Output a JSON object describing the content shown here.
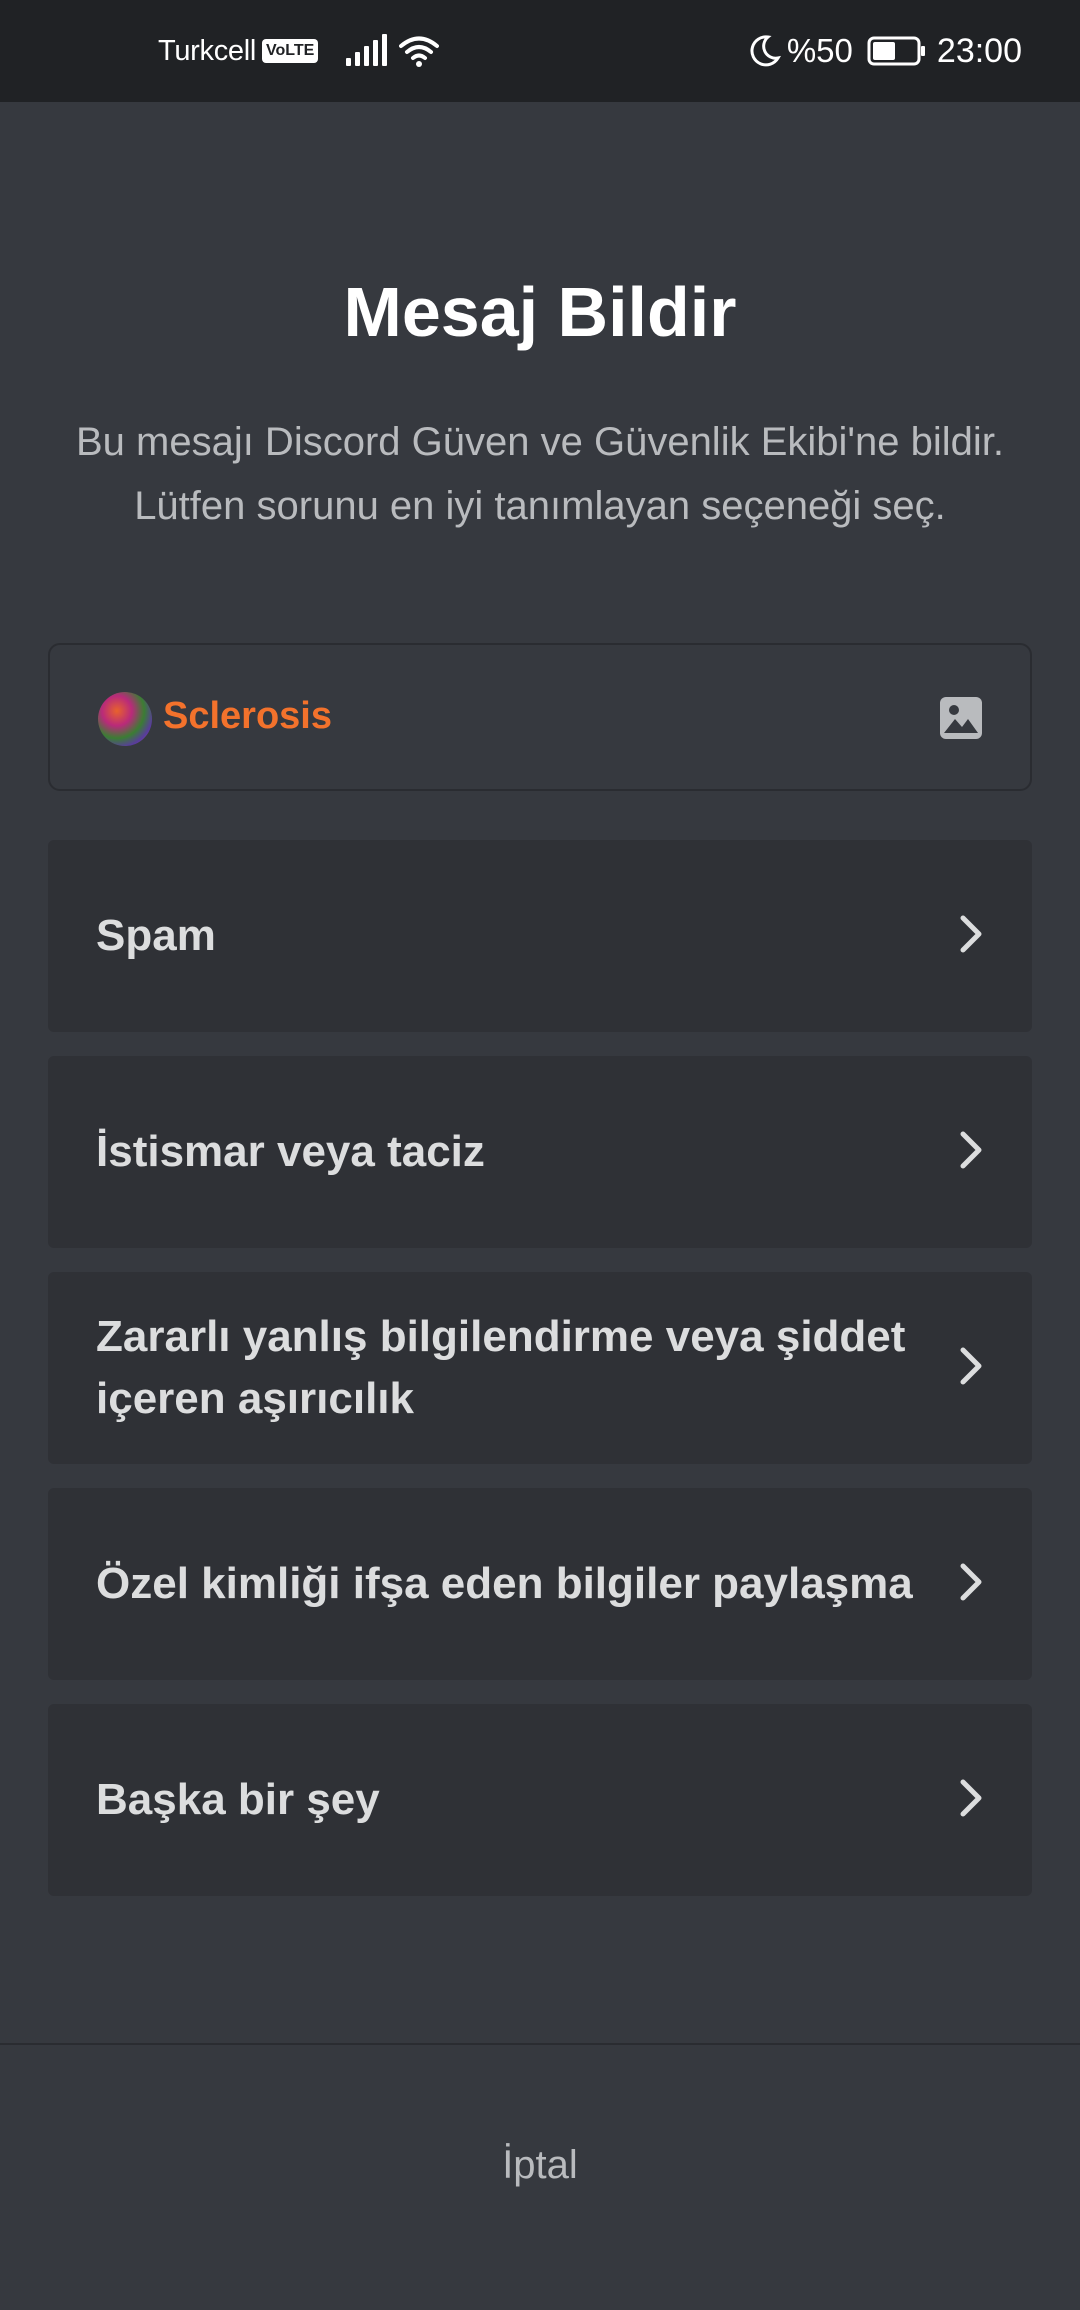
{
  "status_bar": {
    "carrier": "Turkcell",
    "volte": "VoLTE",
    "battery_pct": "%50",
    "time": "23:00",
    "icons": [
      "signal-icon",
      "wifi-icon",
      "moon-icon",
      "battery-icon"
    ]
  },
  "dialog": {
    "title": "Mesaj Bildir",
    "subtitle": "Bu mesajı Discord Güven ve Güvenlik Ekibi'ne bildir. Lütfen sorunu en iyi tanımlayan seçeneği seç.",
    "message_preview": {
      "username": "Sclerosis",
      "username_color": "#f3722c",
      "attachment_icon": "image-icon"
    },
    "options": [
      {
        "label": "Spam"
      },
      {
        "label": "İstismar veya taciz"
      },
      {
        "label": "Zararlı yanlış bilgilendirme veya şiddet içeren aşırıcılık"
      },
      {
        "label": "Özel kimliği ifşa eden bilgiler paylaşma"
      },
      {
        "label": "Başka bir şey"
      }
    ],
    "cancel_label": "İptal"
  },
  "colors": {
    "background": "#36393f",
    "status_bar": "#202225",
    "option_bg": "#2f3136",
    "title": "#ffffff",
    "text_muted": "#b9bbbe"
  }
}
